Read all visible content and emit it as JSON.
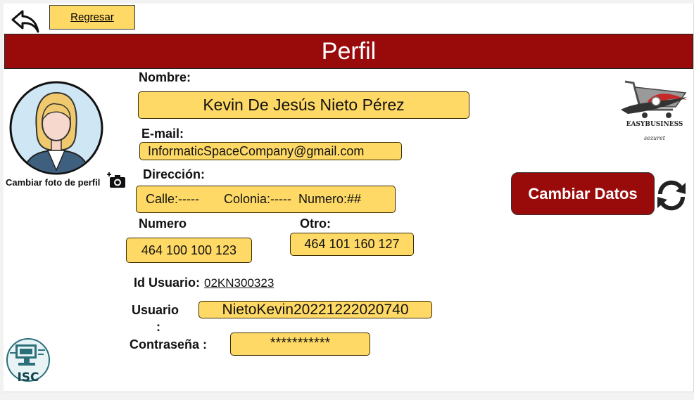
{
  "header": {
    "back_label": "Regresar",
    "title": "Perfil"
  },
  "profile": {
    "change_photo_label": "Cambiar foto de perfil",
    "nombre_label": "Nombre:",
    "nombre_value": "Kevin De Jesús Nieto Pérez",
    "email_label": "E-mail:",
    "email_value": "InformaticSpaceCompany@gmail.com",
    "direccion_label": "Dirección:",
    "direccion_value": "Calle:-----       Colonia:-----  Numero:##",
    "numero_label": "Numero",
    "numero_value": "464 100 100 123",
    "otro_label": "Otro:",
    "otro_value": "464 101 160 127",
    "id_label": "Id Usuario:",
    "id_value": "02KN300323",
    "usuario_label": "Usuario",
    "usuario_colon": ":",
    "usuario_value": "NietoKevin20221222020740",
    "password_label": "Contraseña :",
    "password_value": "***********"
  },
  "actions": {
    "change_data_label": "Cambiar Datos"
  },
  "logos": {
    "easybusiness_text": "EASYBUSINESS",
    "easybusiness_sub": "sezuret",
    "isc_text": "ISC"
  },
  "colors": {
    "title_bar": "#990a0a",
    "field_fill": "#ffd966",
    "button_fill": "#990a0a"
  }
}
